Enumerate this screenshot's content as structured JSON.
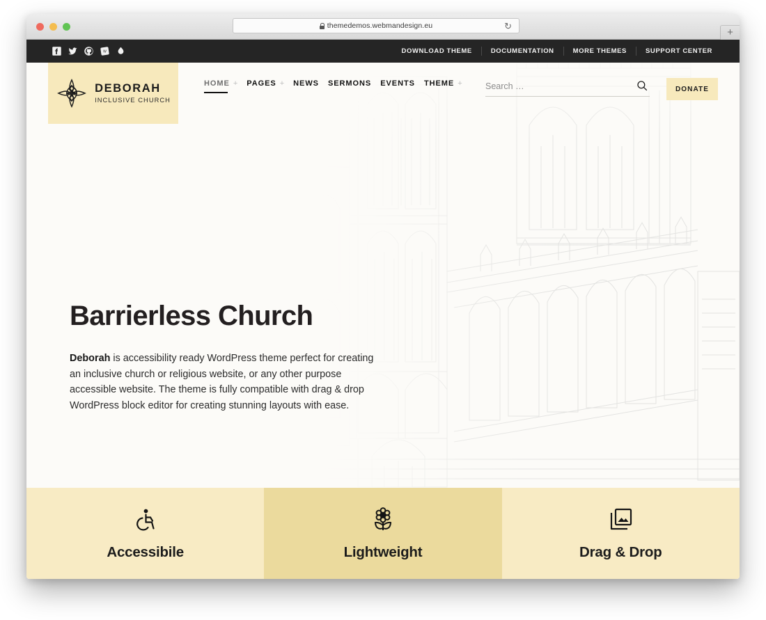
{
  "browser": {
    "url": "themedemos.webmandesign.eu",
    "lock_icon": "lock-icon",
    "reload_icon": "reload-icon",
    "newtab_label": "+",
    "traffic_lights": [
      "close-red",
      "minimize-yellow",
      "zoom-green"
    ]
  },
  "topbar": {
    "social": [
      {
        "name": "facebook-icon",
        "label": "Facebook"
      },
      {
        "name": "twitter-icon",
        "label": "Twitter"
      },
      {
        "name": "github-icon",
        "label": "GitHub"
      },
      {
        "name": "wordpress-icon",
        "label": "WordPress"
      },
      {
        "name": "droplet-icon",
        "label": "Droplet"
      }
    ],
    "links": [
      {
        "label": "DOWNLOAD THEME"
      },
      {
        "label": "DOCUMENTATION"
      },
      {
        "label": "MORE THEMES"
      },
      {
        "label": "SUPPORT CENTER"
      }
    ]
  },
  "header": {
    "logo": {
      "name": "DEBORAH",
      "tagline": "INCLUSIVE CHURCH",
      "icon": "flower-cross-logo-icon",
      "background": "#f7e9bc"
    },
    "nav": [
      {
        "label": "HOME",
        "has_submenu": true,
        "current": true
      },
      {
        "label": "PAGES",
        "has_submenu": true,
        "current": false
      },
      {
        "label": "NEWS",
        "has_submenu": false,
        "current": false
      },
      {
        "label": "SERMONS",
        "has_submenu": false,
        "current": false
      },
      {
        "label": "EVENTS",
        "has_submenu": false,
        "current": false
      },
      {
        "label": "THEME",
        "has_submenu": true,
        "current": false
      }
    ],
    "submenu_indicator": "+",
    "search": {
      "placeholder": "Search …",
      "value": "",
      "icon": "search-icon"
    },
    "donate_label": "DONATE"
  },
  "hero": {
    "title": "Barrierless Church",
    "lead_bold": "Deborah",
    "paragraph": " is accessibility ready WordPress theme perfect for creating an inclusive church or religious website, or any other purpose accessible website. The theme is fully compatible with drag & drop WordPress block editor for creating stunning layouts with ease.",
    "background_image": "gothic-cathedral-engraving"
  },
  "features": [
    {
      "label": "Accessibile",
      "icon": "wheelchair-accessibility-icon",
      "background": "#f8ebc4",
      "highlighted": false
    },
    {
      "label": "Lightweight",
      "icon": "flower-icon",
      "background": "#ebda9d",
      "highlighted": true
    },
    {
      "label": "Drag & Drop",
      "icon": "images-gallery-icon",
      "background": "#f8ebc4",
      "highlighted": false
    }
  ],
  "colors": {
    "cream": "#f7e9bc",
    "cream_light": "#f8ebc4",
    "cream_dark": "#ebda9d",
    "dark_bar": "#252525",
    "page_bg": "#fcfbf8",
    "text_dark": "#1b1b1b"
  }
}
